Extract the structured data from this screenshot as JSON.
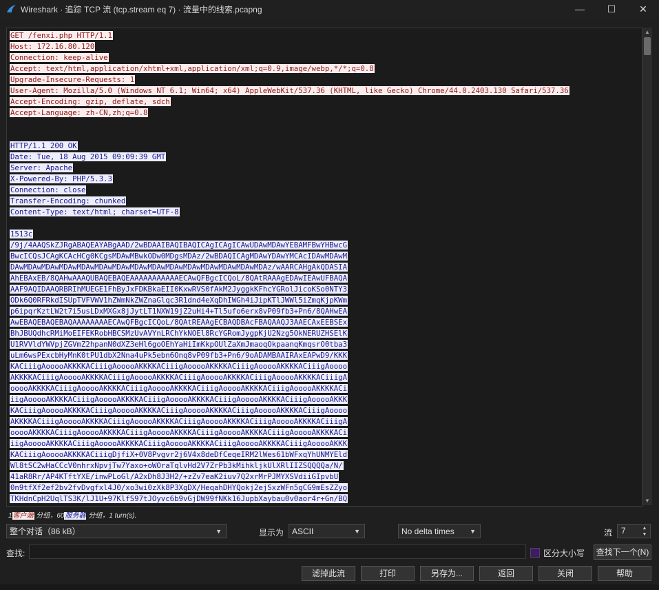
{
  "window": {
    "title": "Wireshark · 追踪 TCP 流 (tcp.stream eq 7) · 流量中的线索.pcapng"
  },
  "stream": {
    "request_lines": [
      "GET /fenxi.php HTTP/1.1",
      "Host: 172.16.80.120",
      "Connection: keep-alive",
      "Accept: text/html,application/xhtml+xml,application/xml;q=0.9,image/webp,*/*;q=0.8",
      "Upgrade-Insecure-Requests: 1",
      "User-Agent: Mozilla/5.0 (Windows NT 6.1; Win64; x64) AppleWebKit/537.36 (KHTML, like Gecko) Chrome/44.0.2403.130 Safari/537.36",
      "Accept-Encoding: gzip, deflate, sdch",
      "Accept-Language: zh-CN,zh;q=0.8"
    ],
    "response_header_lines": [
      "HTTP/1.1 200 OK",
      "Date: Tue, 18 Aug 2015 09:09:39 GMT",
      "Server: Apache",
      "X-Powered-By: PHP/5.3.3",
      "Connection: close",
      "Transfer-Encoding: chunked",
      "Content-Type: text/html; charset=UTF-8"
    ],
    "response_body_lines": [
      "1513c",
      "/9j/4AAQSkZJRgABAQEAYABgAAD/2wBDAAIBAQIBAQICAgICAgICAwUDAwMDAwYEBAMFBwYHBwcG",
      "BwcICQsJCAgKCAcHCg0KCgsMDAwMBwkODw0MDgsMDAz/2wBDAQICAgMDAwYDAwYMCAcIDAwMDAwM",
      "DAwMDAwMDAwMDAwMDAwMDAwMDAwMDAwMDAwMDAwMDAwMDAwMDAwMDAwMDAz/wAARCAHgAkQDASIA",
      "AhEBAxEB/8QAHwAAAQUBAQEBAQEAAAAAAAAAAAECAwQFBgcICQoL/8QAtRAAAgEDAwIEAwUFBAQA",
      "AAF9AQIDAAQRBRIhMUEGE1FhByJxFDKBkaEII0KxwRVS0fAkM2JyggkKFhcYGRolJicoKSo0NTY3",
      "ODk6Q0RFRkdISUpTVFVWV1hZWmNkZWZnaGlqc3R1dnd4eXqDhIWGh4iJipKTlJWWl5iZmqKjpKWm",
      "p6ipqrKztLW2t7i5usLDxMXGx8jJytLT1NXW19jZ2uHi4+Tl5ufo6erx8vP09fb3+Pn6/8QAHwEA",
      "AwEBAQEBAQEBAQAAAAAAAAECAwQFBgcICQoL/8QAtREAAgECBAQDBAcFBAQAAQJ3AAECAxEEBSEx",
      "BhJBUQdhcRMiMoEIFEKRobHBCSMzUvAVYnLRChYkNOEl8RcYGRomJygpKjU2Nzg5OkNERUZHSElK",
      "U1RVVldYWVpjZGVmZ2hpanN0dXZ3eHl6goOEhYaHiImKkpOUlZaXmJmaoqOkpaanqKmqsrO0tba3",
      "uLm6wsPExcbHyMnK0tPU1dbX2Nna4uPk5ebn6Onq8vP09fb3+Pn6/9oADAMBAAIRAxEAPwD9/KKK",
      "KACiiigAooooAKKKKACiiigAooooAKKKKACiiigAooooAKKKKACiiigAooooAKKKKACiiigAoooo",
      "AKKKKACiiigAooooAKKKKACiiigAooooAKKKKACiiigAooooAKKKKACiiigAooooAKKKKACiiigA",
      "ooooAKKKKACiiigAooooAKKKKACiiigAooooAKKKKACiiigAooooAKKKKACiiigAooooAKKKKACi",
      "iigAooooAKKKKACiiigAooooAKKKKACiiigAooooAKKKKACiiigAooooAKKKKACiiigAooooAKKK",
      "KACiiigAooooAKKKKACiiigAooooAKKKKACiiigAooooAKKKKACiiigAooooAKKKKACiiigAoooo",
      "AKKKKACiiigAooooAKKKKACiiigAooooAKKKKACiiigAooooAKKKKACiiigAooooAKKKKACiiigA",
      "ooooAKKKKACiiigAooooAKKKKACiiigAooooAKKKKACiiigAooooAKKKKACiiigAooooAKKKKACi",
      "iigAooooAKKKKACiiigAooooAKKKKACiiigAooooAKKKKACiiigAooooAKKKKACiiigAooooAKKK",
      "KACiiigAooooAKKKKACiiigDjfiX+0V8Pvgvr2j6V4x8deDfCeqeIRM2lWes61bWFxqYhUNMYEld",
      "Wl8tSC2wHaCCcV0nhrxNpvjTw7Yaxo+oWOraTqlvHd2V7ZrPb3kMihkljkUlXRlIIZSQQQQa/N/",
      "41aR8Rr/AP4KTftYXE/inwPLoGl/A2xDh8J3H2/+zZv7eaK2iuv7Q2xrMrPJMYXSVdiiGIpvbU",
      "0n9tfXf2ef2bv2fvDvgfxl4J0/xo3wi0zXk8P3XgDX/HeqahDHYQokj2ejSxzWFn5gCG9mEsZZyo",
      "TKHdnCpH2UqlTS3K/lJ1U+97KlfS97tJOyvc6b9vGjDW99fNKk16JupbXaybau0v0aor4r+Gn/BQ"
    ],
    "status_prefix": "1",
    "status_client": "客户端",
    "status_mid": " 分组，60",
    "status_server": "服务器",
    "status_suffix": " 分组，1 turn(s)."
  },
  "controls": {
    "conversation_select": "整个对话（86 kB）",
    "show_as_label": "显示为",
    "show_as_select": "ASCII",
    "delta_select": "No delta times",
    "stream_label": "流",
    "stream_value": "7",
    "find_label": "查找:",
    "find_placeholder": "",
    "case_sensitive_label": "区分大小写",
    "find_next_button": "查找下一个(N)"
  },
  "buttons": {
    "filter_out": "滤掉此流",
    "print": "打印",
    "save_as": "另存为...",
    "back": "返回",
    "close": "关闭",
    "help": "帮助"
  },
  "colors": {
    "client_bg": "#fbeded",
    "client_fg": "#8f1a1a",
    "server_bg": "#ededfb",
    "server_fg": "#1a1a8f"
  }
}
